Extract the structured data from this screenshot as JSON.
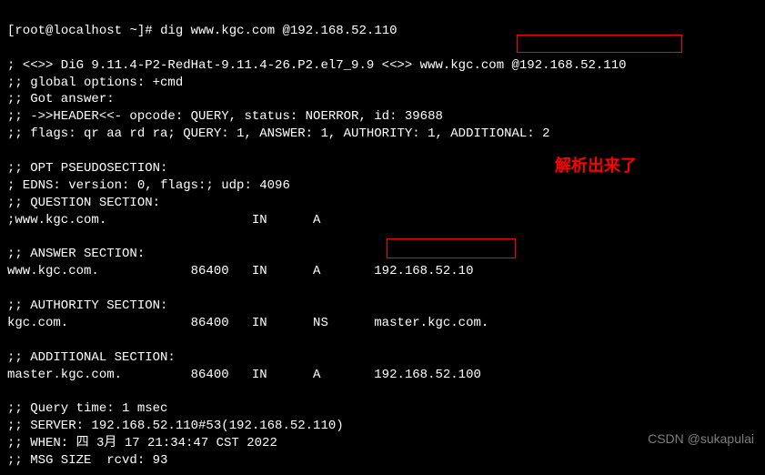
{
  "prompt": {
    "user": "root",
    "host": "localhost",
    "path": "~",
    "symbol": "#",
    "command": "dig www.kgc.com @192.168.52.110"
  },
  "dig": {
    "banner": "; <<>> DiG 9.11.4-P2-RedHat-9.11.4-26.P2.el7_9.9 <<>> www.kgc.com @192.168.52.110",
    "global_options": ";; global options: +cmd",
    "got_answer": ";; Got answer:",
    "header": ";; ->>HEADER<<- opcode: QUERY, status: NOERROR, id: 39688",
    "flags": ";; flags: qr aa rd ra; QUERY: 1, ANSWER: 1, AUTHORITY: 1, ADDITIONAL: 2",
    "opt_section_title": ";; OPT PSEUDOSECTION:",
    "edns": "; EDNS: version: 0, flags:; udp: 4096",
    "question_title": ";; QUESTION SECTION:",
    "question_line": ";www.kgc.com.                   IN      A",
    "answer_title": ";; ANSWER SECTION:",
    "answer_line": "www.kgc.com.            86400   IN      A       192.168.52.10",
    "authority_title": ";; AUTHORITY SECTION:",
    "authority_line": "kgc.com.                86400   IN      NS      master.kgc.com.",
    "additional_title": ";; ADDITIONAL SECTION:",
    "additional_line": "master.kgc.com.         86400   IN      A       192.168.52.100",
    "query_time": ";; Query time: 1 msec",
    "server": ";; SERVER: 192.168.52.110#53(192.168.52.110)",
    "when": ";; WHEN: 四 3月 17 21:34:47 CST 2022",
    "msg_size": ";; MSG SIZE  rcvd: 93"
  },
  "annotation": "解析出来了",
  "watermark": "CSDN @sukapulai"
}
